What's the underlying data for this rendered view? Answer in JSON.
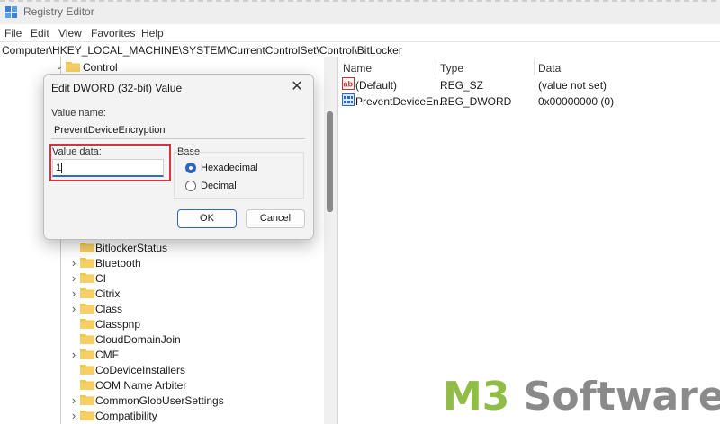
{
  "window": {
    "title": "Registry Editor"
  },
  "menu": [
    "File",
    "Edit",
    "View",
    "Favorites",
    "Help"
  ],
  "address": "Computer\\HKEY_LOCAL_MACHINE\\SYSTEM\\CurrentControlSet\\Control\\BitLocker",
  "tree": {
    "parent": "Control",
    "items": [
      {
        "label": "BitlockerStatus",
        "expandable": false
      },
      {
        "label": "Bluetooth",
        "expandable": true
      },
      {
        "label": "CI",
        "expandable": true
      },
      {
        "label": "Citrix",
        "expandable": true
      },
      {
        "label": "Class",
        "expandable": true
      },
      {
        "label": "Classpnp",
        "expandable": false
      },
      {
        "label": "CloudDomainJoin",
        "expandable": false
      },
      {
        "label": "CMF",
        "expandable": true
      },
      {
        "label": "CoDeviceInstallers",
        "expandable": false
      },
      {
        "label": "COM Name Arbiter",
        "expandable": false
      },
      {
        "label": "CommonGlobUserSettings",
        "expandable": true
      },
      {
        "label": "Compatibility",
        "expandable": true
      }
    ]
  },
  "list": {
    "columns": [
      "Name",
      "Type",
      "Data"
    ],
    "rows": [
      {
        "name": "(Default)",
        "type": "REG_SZ",
        "data": "(value not set)",
        "icon": "string-value-icon"
      },
      {
        "name": "PreventDeviceEn...",
        "type": "REG_DWORD",
        "data": "0x00000000 (0)",
        "icon": "dword-value-icon"
      }
    ]
  },
  "dialog": {
    "title": "Edit DWORD (32-bit) Value",
    "value_name_label": "Value name:",
    "value_name": "PreventDeviceEncryption",
    "value_data_label": "Value data:",
    "value_data": "1",
    "base_label": "Base",
    "base_options": [
      "Hexadecimal",
      "Decimal"
    ],
    "base_selected": "Hexadecimal",
    "ok_label": "OK",
    "cancel_label": "Cancel"
  },
  "watermark": {
    "part1": "M3",
    "part2": " Software"
  },
  "colors": {
    "highlight_border": "#d9323f",
    "accent": "#2d66c2",
    "watermark_green": "#8fbd45"
  }
}
